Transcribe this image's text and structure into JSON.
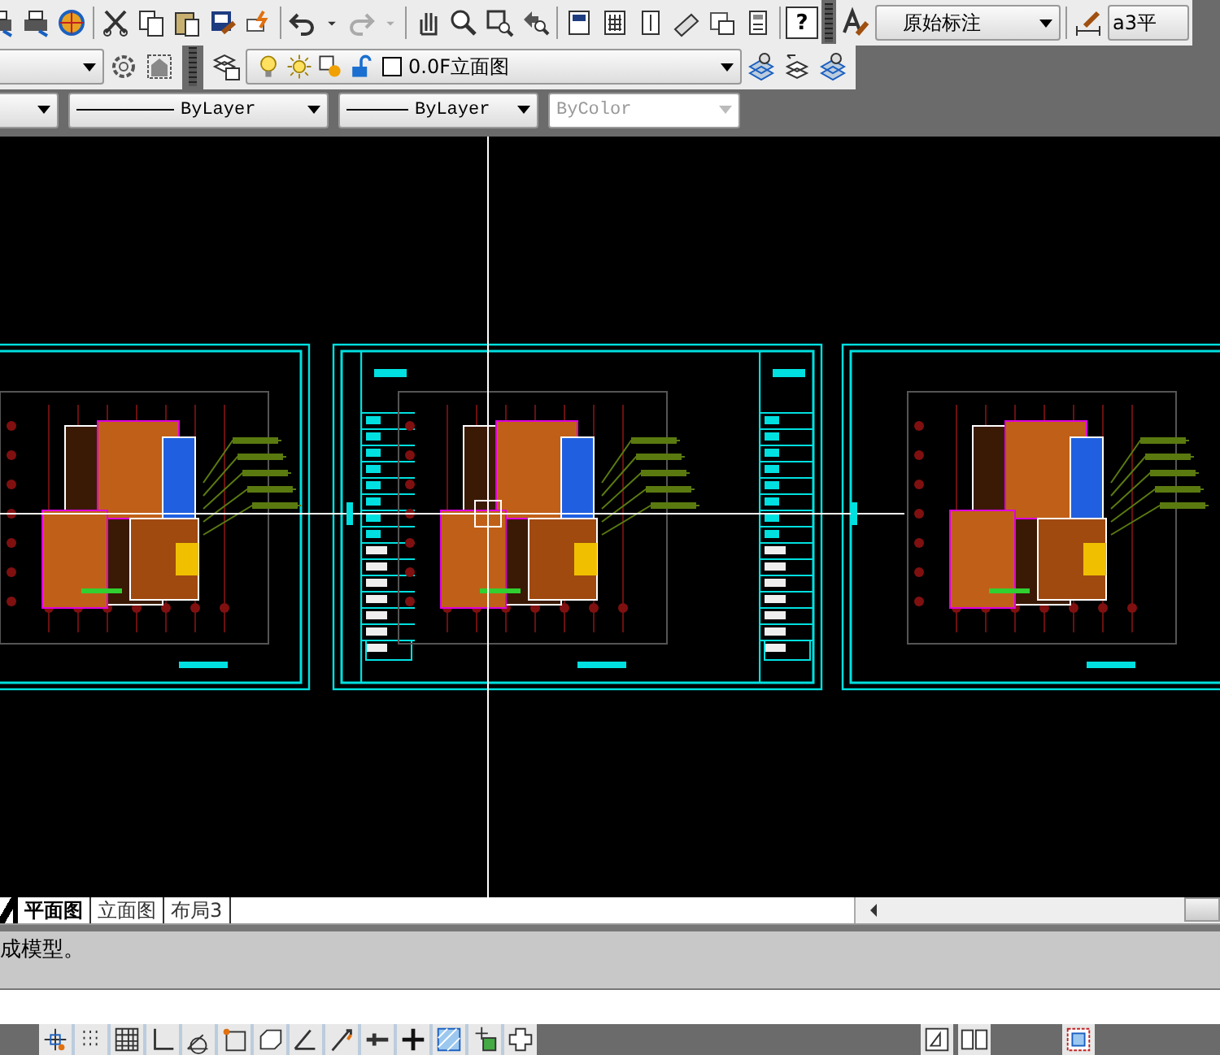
{
  "standard_toolbar": {
    "help_button": "?",
    "text_style": "原始标注",
    "dim_style": "a3平"
  },
  "layers_toolbar": {
    "current_layer": "0.0F立面图"
  },
  "properties_toolbar": {
    "linetype": "ByLayer",
    "lineweight": "ByLayer",
    "plot_style": {
      "value": "ByColor",
      "disabled": true
    }
  },
  "layout_tabs": [
    {
      "label": "平面图",
      "selected": true
    },
    {
      "label": "立面图",
      "selected": false
    },
    {
      "label": "布局3",
      "selected": false
    }
  ],
  "command_line": {
    "history": "成模型。"
  }
}
